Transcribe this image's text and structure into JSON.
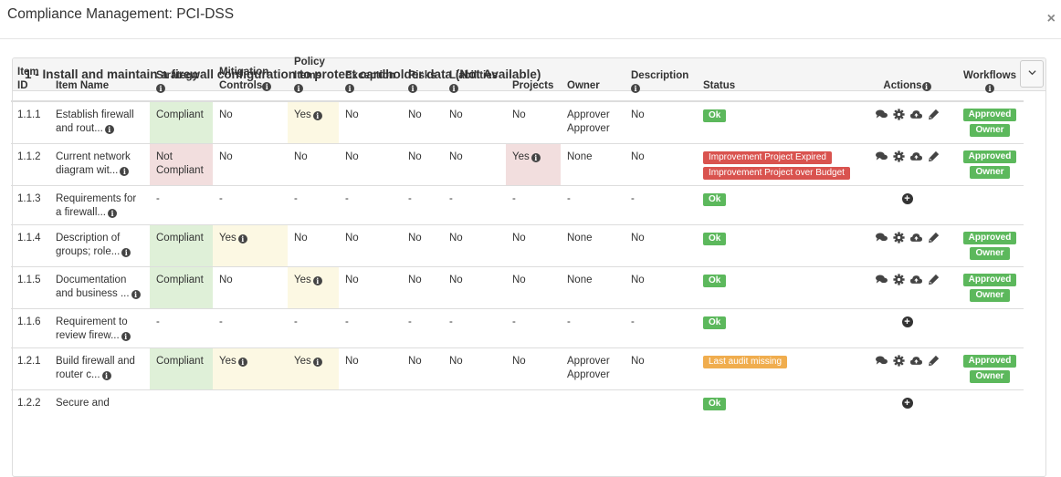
{
  "modal": {
    "title": "Compliance Management: PCI-DSS",
    "close_label": "×"
  },
  "panel": {
    "title": "1 - Install and maintain a firewall configuration to protect cardholder data (Not Available)",
    "collapse_icon": "chevron-down-icon"
  },
  "headers": {
    "item_id": "Item ID",
    "item_name": "Item Name",
    "strategy": "Strategy",
    "mitigation": "Mitigation Controls",
    "policy": "Policy Items",
    "exception": "Exception",
    "risks": "Risks",
    "liabilities": "Liabilities",
    "projects": "Projects",
    "owner": "Owner",
    "description": "Description",
    "status": "Status",
    "actions": "Actions",
    "workflows": "Workflows"
  },
  "rows": [
    {
      "id": "1.1.1",
      "name": "Establish firewall and rout...",
      "strategy": "Compliant",
      "mitigation": "No",
      "policy": "Yes",
      "exception": "No",
      "risks": "No",
      "liabilities": "No",
      "projects": "No",
      "owner": "Approver Approver",
      "description": "No",
      "status": [
        "Ok"
      ],
      "wf_top": "Approved",
      "wf_bottom": "Owner"
    },
    {
      "id": "1.1.2",
      "name": "Current network diagram wit...",
      "strategy": "Not Compliant",
      "mitigation": "No",
      "policy": "No",
      "exception": "No",
      "risks": "No",
      "liabilities": "No",
      "projects": "Yes",
      "owner": "None",
      "description": "No",
      "status": [
        "Improvement Project Expired",
        "Improvement Project over Budget"
      ],
      "wf_top": "Approved",
      "wf_bottom": "Owner"
    },
    {
      "id": "1.1.3",
      "name": "Requirements for a firewall...",
      "strategy": "-",
      "mitigation": "-",
      "policy": "-",
      "exception": "-",
      "risks": "-",
      "liabilities": "-",
      "projects": "-",
      "owner": "-",
      "description": "-",
      "status": [
        "Ok"
      ]
    },
    {
      "id": "1.1.4",
      "name": "Description of groups; role...",
      "strategy": "Compliant",
      "mitigation": "Yes",
      "policy": "No",
      "exception": "No",
      "risks": "No",
      "liabilities": "No",
      "projects": "No",
      "owner": "None",
      "description": "No",
      "status": [
        "Ok"
      ],
      "wf_top": "Approved",
      "wf_bottom": "Owner"
    },
    {
      "id": "1.1.5",
      "name": "Documentation and business ...",
      "strategy": "Compliant",
      "mitigation": "No",
      "policy": "Yes",
      "exception": "No",
      "risks": "No",
      "liabilities": "No",
      "projects": "No",
      "owner": "None",
      "description": "No",
      "status": [
        "Ok"
      ],
      "wf_top": "Approved",
      "wf_bottom": "Owner"
    },
    {
      "id": "1.1.6",
      "name": "Requirement to review firew...",
      "strategy": "-",
      "mitigation": "-",
      "policy": "-",
      "exception": "-",
      "risks": "-",
      "liabilities": "-",
      "projects": "-",
      "owner": "-",
      "description": "-",
      "status": [
        "Ok"
      ]
    },
    {
      "id": "1.2.1",
      "name": "Build firewall and router c...",
      "strategy": "Compliant",
      "mitigation": "Yes",
      "policy": "Yes",
      "exception": "No",
      "risks": "No",
      "liabilities": "No",
      "projects": "No",
      "owner": "Approver Approver",
      "description": "No",
      "status": [
        "Last audit missing"
      ],
      "wf_top": "Approved",
      "wf_bottom": "Owner"
    },
    {
      "id": "1.2.2",
      "name": "Secure and",
      "strategy": "",
      "mitigation": "",
      "policy": "",
      "exception": "",
      "risks": "",
      "liabilities": "",
      "projects": "",
      "owner": "",
      "description": "",
      "status": [
        "Ok"
      ]
    }
  ],
  "action_icons": [
    "comments-icon",
    "gear-icon",
    "cloud-upload-icon",
    "pencil-icon"
  ],
  "add_icon": "plus-circle-icon",
  "info_icon": "info-circle-icon",
  "colors": {
    "compliant_bg": "#dff0d8",
    "not_compliant_bg": "#f2dede",
    "yes_bg": "#fcf8e3",
    "ok": "#5cb85c",
    "danger": "#d9534f",
    "warning": "#f0ad4e"
  }
}
